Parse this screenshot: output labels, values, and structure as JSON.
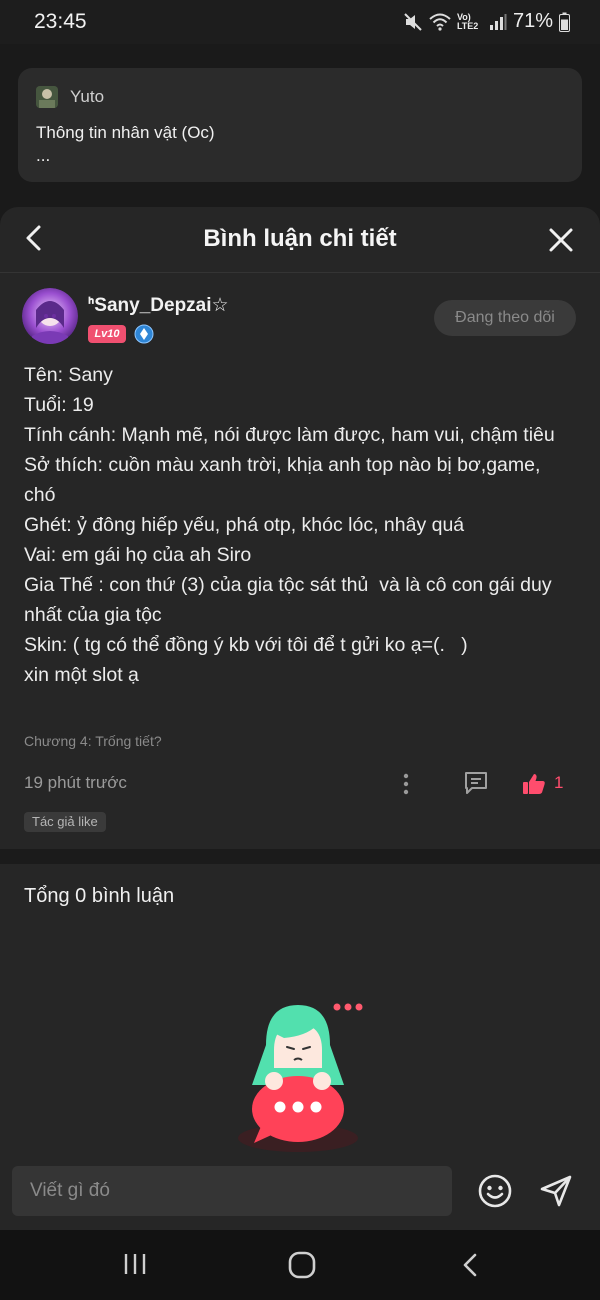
{
  "status_bar": {
    "time": "23:45",
    "network": "Vo) LTE2",
    "battery": "71%"
  },
  "background_post": {
    "author": "Yuto",
    "title": "Thông tin nhân vật (Oc)",
    "excerpt": "..."
  },
  "sheet": {
    "title": "Bình luận chi tiết"
  },
  "comment": {
    "username": "ᑋSany_Depzai☆",
    "level": "Lv10",
    "follow_label": "Đang theo dõi",
    "lines": [
      "Tên: Sany",
      "Tuổi: 19",
      "Tính cánh: Mạnh mẽ, nói được làm được, ham vui, chậm tiêu",
      "Sở thích: cuồn màu xanh trời, khịa anh top nào bị bơ,game, chó",
      "Ghét: ỷ đông hiếp yếu, phá otp, khóc lóc, nhây quá",
      "Vai: em gái họ của ah Siro",
      "Gia Thế : con thứ (3) của gia tộc sát thủ  và là cô con gái duy nhất của gia tộc",
      "Skin: ( tg có thể đồng ý kb với tôi để t gửi ko ạ=(.   )",
      "xin một slot ạ"
    ],
    "chapter": "Chương 4: Trống tiết?",
    "time": "19 phút trước",
    "like_count": "1",
    "author_like": "Tác giả like"
  },
  "replies": {
    "total_label": "Tổng 0 bình luận"
  },
  "input": {
    "placeholder": "Viết gì đó"
  },
  "colors": {
    "accent": "#ff4d6d",
    "level_badge": "#f05070",
    "background": "#262626"
  }
}
